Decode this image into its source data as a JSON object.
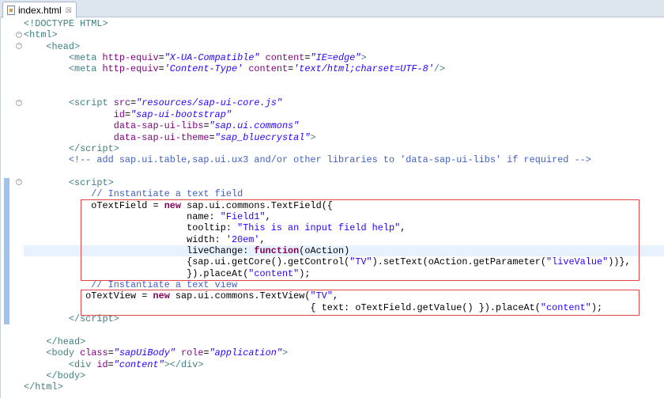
{
  "tab": {
    "label": "index.html",
    "close": "☒"
  },
  "colors": {
    "tag": "#3f7f7f",
    "attr": "#7f007f",
    "value": "#2a00ff",
    "comment": "#3f5fbf",
    "keyword": "#7f0055",
    "box": "#e0474c"
  },
  "code": {
    "lines": [
      [
        {
          "c": "t",
          "t": "<!DOCTYPE HTML>"
        }
      ],
      [
        {
          "c": "t",
          "t": "<html>"
        }
      ],
      [
        {
          "c": "t",
          "t": "    <head>"
        }
      ],
      [
        {
          "c": "t",
          "t": "        <meta"
        },
        {
          "c": "a",
          "t": " http-equiv"
        },
        {
          "c": "p",
          "t": "="
        },
        {
          "c": "v",
          "t": "\"X-UA-Compatible\""
        },
        {
          "c": "a",
          "t": " content"
        },
        {
          "c": "p",
          "t": "="
        },
        {
          "c": "v",
          "t": "\"IE=edge\""
        },
        {
          "c": "t",
          "t": ">"
        }
      ],
      [
        {
          "c": "t",
          "t": "        <meta"
        },
        {
          "c": "a",
          "t": " http-equiv"
        },
        {
          "c": "p",
          "t": "="
        },
        {
          "c": "v",
          "t": "'Content-Type'"
        },
        {
          "c": "a",
          "t": " content"
        },
        {
          "c": "p",
          "t": "="
        },
        {
          "c": "v",
          "t": "'text/html;charset=UTF-8'"
        },
        {
          "c": "t",
          "t": "/>"
        }
      ],
      [],
      [],
      [
        {
          "c": "t",
          "t": "        <script"
        },
        {
          "c": "a",
          "t": " src"
        },
        {
          "c": "p",
          "t": "="
        },
        {
          "c": "v",
          "t": "\"resources/sap-ui-core.js\""
        }
      ],
      [
        {
          "c": "a",
          "t": "                id"
        },
        {
          "c": "p",
          "t": "="
        },
        {
          "c": "v",
          "t": "\"sap-ui-bootstrap\""
        }
      ],
      [
        {
          "c": "a",
          "t": "                data-sap-ui-libs"
        },
        {
          "c": "p",
          "t": "="
        },
        {
          "c": "v",
          "t": "\"sap.ui.commons\""
        }
      ],
      [
        {
          "c": "a",
          "t": "                data-sap-ui-theme"
        },
        {
          "c": "p",
          "t": "="
        },
        {
          "c": "v",
          "t": "\"sap_bluecrystal\""
        },
        {
          "c": "t",
          "t": ">"
        }
      ],
      [
        {
          "c": "t",
          "t": "        </script>"
        }
      ],
      [
        {
          "c": "c",
          "t": "        <!-- add sap.ui.table,sap.ui.ux3 and/or other libraries to 'data-sap-ui-libs' if required -->"
        }
      ],
      [],
      [
        {
          "c": "t",
          "t": "        <script>"
        }
      ],
      [
        {
          "c": "c",
          "t": "            // Instantiate a text field"
        }
      ],
      [
        {
          "c": "p",
          "t": "            oTextField = "
        },
        {
          "c": "k",
          "t": "new"
        },
        {
          "c": "p",
          "t": " sap.ui.commons.TextField({"
        }
      ],
      [
        {
          "c": "p",
          "t": "                             name: "
        },
        {
          "c": "s",
          "t": "\"Field1\""
        },
        {
          "c": "p",
          "t": ","
        }
      ],
      [
        {
          "c": "p",
          "t": "                             tooltip: "
        },
        {
          "c": "s",
          "t": "\"This is an input field help\""
        },
        {
          "c": "p",
          "t": ","
        }
      ],
      [
        {
          "c": "p",
          "t": "                             width: "
        },
        {
          "c": "s",
          "t": "'20em'"
        },
        {
          "c": "p",
          "t": ","
        }
      ],
      [
        {
          "c": "p",
          "t": "                             liveChange: "
        },
        {
          "c": "k",
          "t": "function"
        },
        {
          "c": "p",
          "t": "(oAction)"
        }
      ],
      [
        {
          "c": "p",
          "t": "                             {sap.ui.getCore().getControl("
        },
        {
          "c": "s",
          "t": "\"TV\""
        },
        {
          "c": "p",
          "t": ").setText(oAction.getParameter("
        },
        {
          "c": "s",
          "t": "\"liveValue\""
        },
        {
          "c": "p",
          "t": "))},"
        }
      ],
      [
        {
          "c": "p",
          "t": "                             }).placeAt("
        },
        {
          "c": "s",
          "t": "\"content\""
        },
        {
          "c": "p",
          "t": ");"
        }
      ],
      [
        {
          "c": "c",
          "t": "            // Instantiate a text view"
        }
      ],
      [
        {
          "c": "p",
          "t": "           oTextView = "
        },
        {
          "c": "k",
          "t": "new"
        },
        {
          "c": "p",
          "t": " sap.ui.commons.TextView("
        },
        {
          "c": "s",
          "t": "\"TV\""
        },
        {
          "c": "p",
          "t": ","
        }
      ],
      [
        {
          "c": "p",
          "t": "                                                   { text: oTextField.getValue() }).placeAt("
        },
        {
          "c": "s",
          "t": "\"content\""
        },
        {
          "c": "p",
          "t": ");"
        }
      ],
      [
        {
          "c": "t",
          "t": "        </script>"
        }
      ],
      [],
      [
        {
          "c": "t",
          "t": "    </head>"
        }
      ],
      [
        {
          "c": "t",
          "t": "    <body"
        },
        {
          "c": "a",
          "t": " class"
        },
        {
          "c": "p",
          "t": "="
        },
        {
          "c": "v",
          "t": "\"sapUiBody\""
        },
        {
          "c": "a",
          "t": " role"
        },
        {
          "c": "p",
          "t": "="
        },
        {
          "c": "v",
          "t": "\"application\""
        },
        {
          "c": "t",
          "t": ">"
        }
      ],
      [
        {
          "c": "t",
          "t": "        <div"
        },
        {
          "c": "a",
          "t": " id"
        },
        {
          "c": "p",
          "t": "="
        },
        {
          "c": "v",
          "t": "\"content\""
        },
        {
          "c": "t",
          "t": "></div>"
        }
      ],
      [
        {
          "c": "t",
          "t": "    </body>"
        }
      ],
      [
        {
          "c": "t",
          "t": "</html>"
        }
      ]
    ]
  }
}
